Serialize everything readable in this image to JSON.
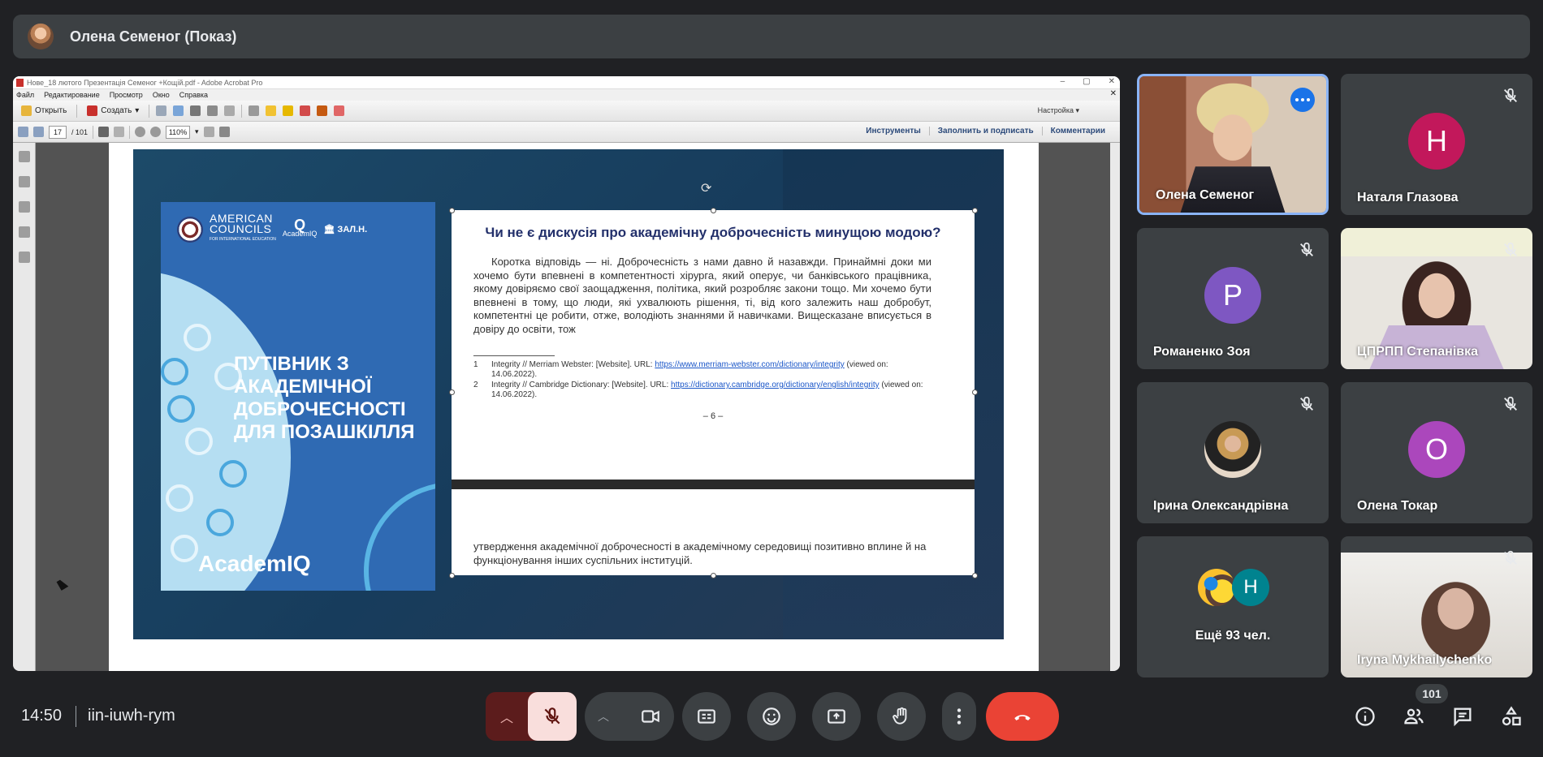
{
  "presenter_bar": {
    "title": "Олена Семеног (Показ)"
  },
  "acrobat": {
    "window_title": "Нове_18 лютого Презентація Семеног +Кощій.pdf - Adobe Acrobat Pro",
    "menu": [
      "Файл",
      "Редактирование",
      "Просмотр",
      "Окно",
      "Справка"
    ],
    "toolbar": {
      "open": "Открыть",
      "create": "Создать",
      "setup": "Настройка"
    },
    "nav": {
      "page": "17",
      "total": "/ 101",
      "zoom": "110%"
    },
    "right_tabs": [
      "Инструменты",
      "Заполнить и подписать",
      "Комментарии"
    ]
  },
  "slide": {
    "cover": {
      "org1": "AMERICAN",
      "org1b": "COUNCILS",
      "org1_sub": "FOR INTERNATIONAL EDUCATION",
      "org2": "AcademIQ",
      "org3": "ЗАЛ.Н.",
      "title": "ПУТІВНИК З АКАДЕМІЧНОЇ ДОБРОЧЕСНОСТІ ДЛЯ ПОЗАШКІЛЛЯ",
      "brand": "AcademIQ"
    },
    "doc": {
      "heading": "Чи не є дискусія про академічну доброчесність минущою модою?",
      "paragraph": "Коротка відповідь — ні. Доброчесність з нами давно й назавжди. Принаймні доки ми хочемо бути впевнені в компетентності хірурга, який оперує, чи банківського працівника, якому довіряємо свої заощадження, політика, який розробляє закони тощо. Ми хочемо бути впевнені в тому, що люди, які ухвалюють рішення, ті, від кого залежить наш добробут, компетентні це робити, отже, володіють знаннями й навичками. Вищесказане вписується в довіру до освіти, тож",
      "footnotes": [
        {
          "num": "1",
          "text": "Integrity // Merriam Webster: [Website]. URL: ",
          "link": "https://www.merriam-webster.com/dictionary/integrity",
          "after": " (viewed on: 14.06.2022)."
        },
        {
          "num": "2",
          "text": "Integrity // Cambridge Dictionary: [Website]. URL: ",
          "link": "https://dictionary.cambridge.org/dictionary/english/integrity",
          "after": " (viewed on: 14.06.2022)."
        }
      ],
      "page_number": "– 6 –",
      "bottom_text": "утвердження академічної доброчесності в академічному середовищі позитивно вплине й на функціонування інших суспільних інституцій."
    }
  },
  "participants": [
    {
      "name": "Олена Семеног",
      "type": "video",
      "active": true
    },
    {
      "name": "Наталя Глазова",
      "type": "avatar",
      "letter": "Н",
      "color": "#c2185b",
      "muted": true
    },
    {
      "name": "Романенко Зоя",
      "type": "avatar",
      "letter": "Р",
      "color": "#7e57c2",
      "muted": true
    },
    {
      "name": "ЦПРПП Степанівка",
      "type": "video",
      "muted": true
    },
    {
      "name": "Ірина Олександрівна",
      "type": "photo",
      "muted": true
    },
    {
      "name": "Олена Токар",
      "type": "avatar",
      "letter": "О",
      "color": "#ab47bc",
      "muted": true
    },
    {
      "name": "Ещё 93 чел.",
      "type": "more",
      "letter": "Н",
      "color": "#00838f"
    },
    {
      "name": "Iryna Mykhailychenko",
      "type": "video",
      "muted": true
    }
  ],
  "bottom_bar": {
    "time": "14:50",
    "meeting_code": "iin-iuwh-rym",
    "participant_count": "101"
  },
  "colors": {
    "accent": "#8ab4f8",
    "hangup": "#ea4335",
    "mic_muted_bg": "#f9dedc",
    "panel": "#3c4043"
  }
}
